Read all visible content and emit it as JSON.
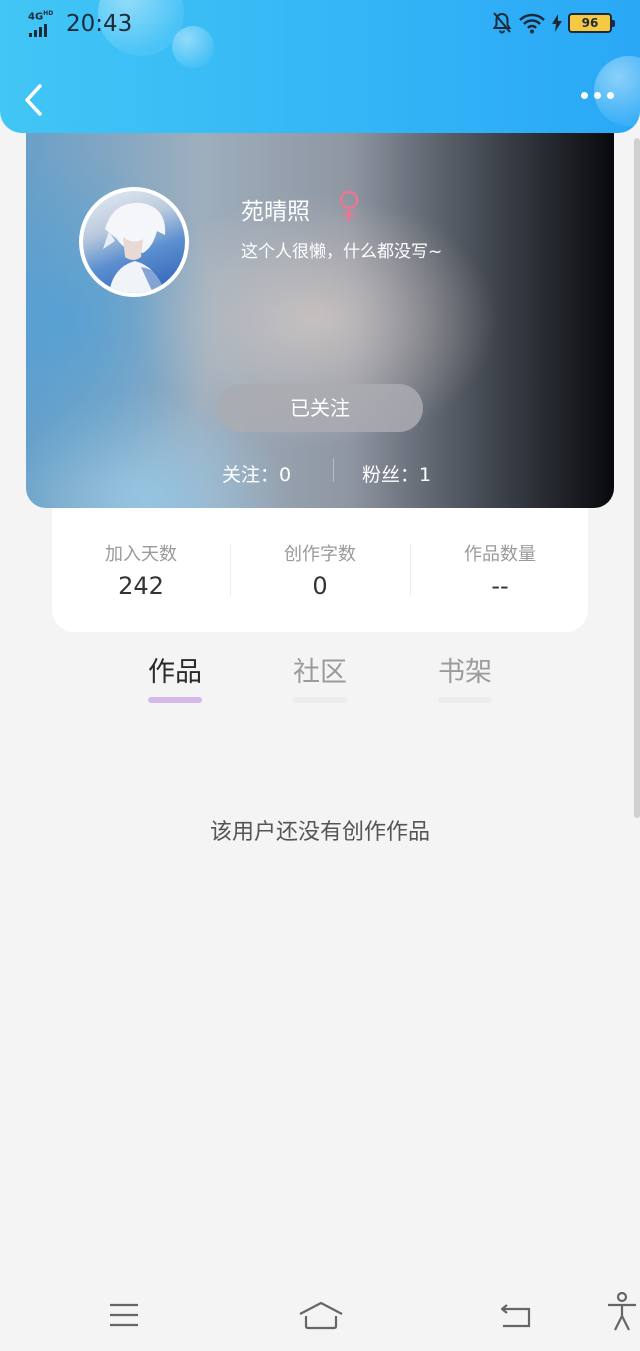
{
  "status_bar": {
    "network": "4G",
    "network_sup": "HD",
    "time": "20:43",
    "battery": "96"
  },
  "profile": {
    "username": "苑晴照",
    "gender_symbol": "♀",
    "bio": "这个人很懒，什么都没写~",
    "follow_label": "已关注",
    "following": "关注：0",
    "fans": "粉丝：1"
  },
  "stats": [
    {
      "label": "加入天数",
      "value": "242"
    },
    {
      "label": "创作字数",
      "value": "0"
    },
    {
      "label": "作品数量",
      "value": "--"
    }
  ],
  "tabs": [
    {
      "label": "作品",
      "active": true
    },
    {
      "label": "社区",
      "active": false
    },
    {
      "label": "书架",
      "active": false
    }
  ],
  "empty_message": "该用户还没有创作作品",
  "colors": {
    "header_gradient_start": "#41c6f5",
    "header_gradient_end": "#2aa8f6",
    "tab_indicator_active": "#d5b9ea",
    "gender": "#e6788f"
  },
  "icons": {
    "back": "chevron-left-icon",
    "more": "more-dots-icon",
    "gender": "female-icon",
    "nav_menu": "menu-icon",
    "nav_home": "home-icon",
    "nav_back": "back-icon",
    "accessibility": "accessibility-icon"
  }
}
